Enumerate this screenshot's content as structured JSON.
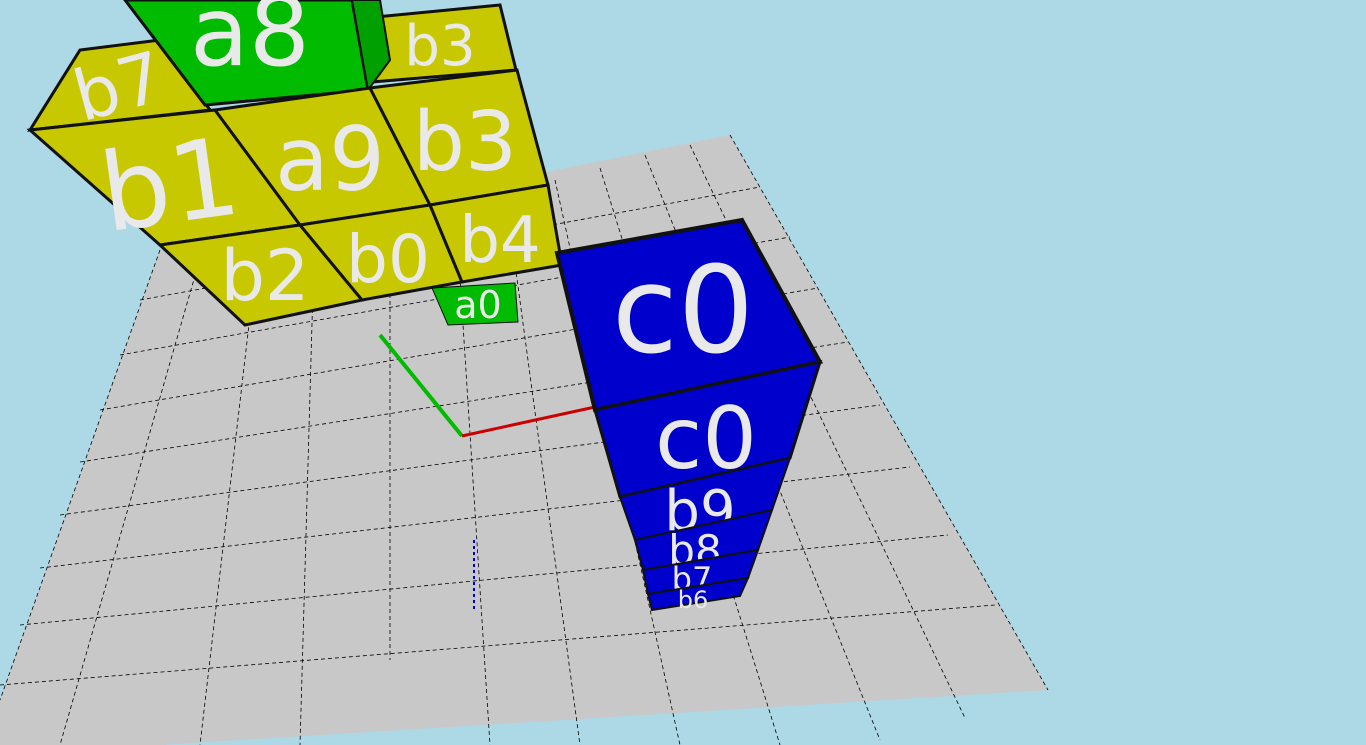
{
  "scene": {
    "background_color": "#add8e6",
    "floor": {
      "color": "#c8c8c8",
      "grid_color": "#000000"
    },
    "axes": {
      "x_color": "#cc0000",
      "y_color": "#00bb00",
      "z_color": "#0000cc"
    },
    "groups": {
      "a": {
        "color": "#00bb00"
      },
      "b": {
        "color": "#c8c800"
      },
      "c": {
        "color": "#0000cc"
      }
    },
    "cube_labels": {
      "a8": "a8",
      "b3_top": "b3",
      "b7": "b7",
      "b1": "b1",
      "a9": "a9",
      "b3_front": "b3",
      "b2": "b2",
      "b0": "b0",
      "b4": "b4",
      "a0": "a0",
      "c0_top": "c0",
      "c0_side": "c0",
      "b9": "b9",
      "b8": "b8",
      "b7_tower": "b7",
      "b6": "b6"
    }
  }
}
